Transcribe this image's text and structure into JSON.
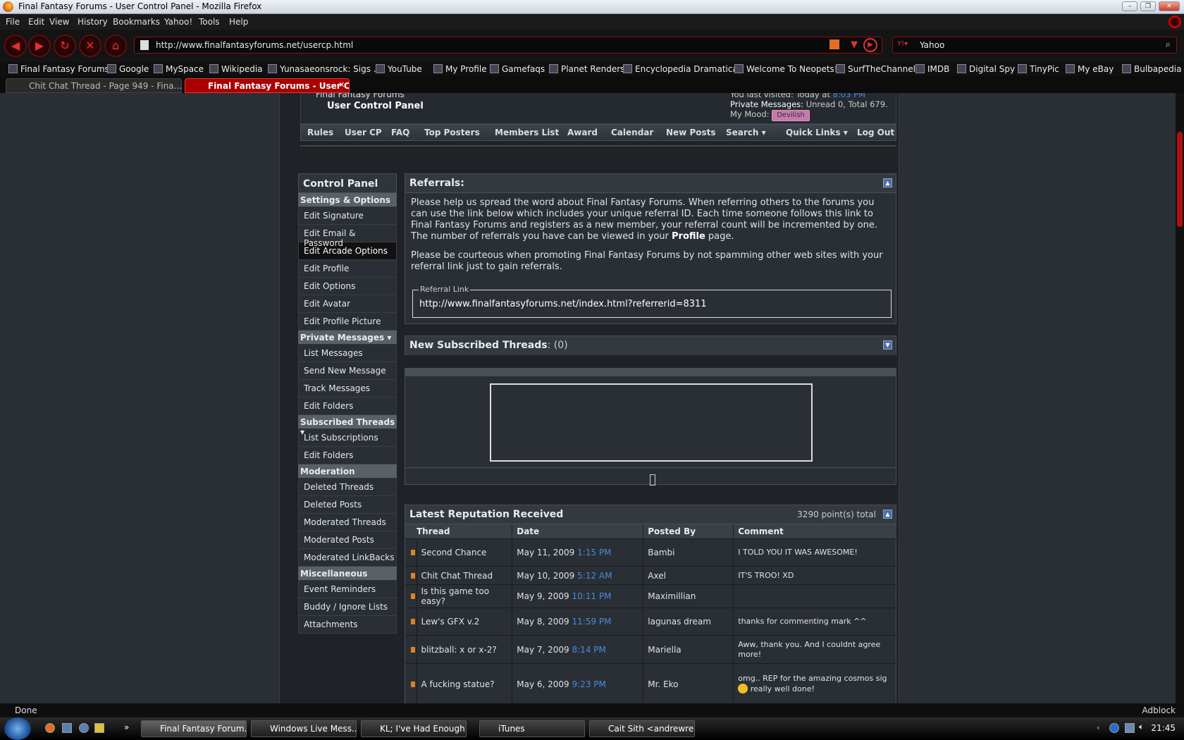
{
  "window": {
    "title": "Final Fantasy Forums - User Control Panel - Mozilla Firefox"
  },
  "menu": [
    "File",
    "Edit",
    "View",
    "History",
    "Bookmarks",
    "Yahoo!",
    "Tools",
    "Help"
  ],
  "nav": {
    "url": "http://www.finalfantasyforums.net/usercp.html",
    "search_value": "Yahoo"
  },
  "bookmarks": [
    "Final Fantasy Forums",
    "Google",
    "MySpace",
    "Wikipedia",
    "Yunasaeonsrock: Sigs ...",
    "YouTube",
    "My Profile",
    "Gamefaqs",
    "Planet Renders",
    "Encyclopedia Dramatica",
    "Welcome To Neopets!",
    "SurfTheChannel",
    "IMDB",
    "Digital Spy",
    "TinyPic",
    "My eBay",
    "Bulbapedia"
  ],
  "tabs": [
    "Chit Chat Thread - Page 949 - Fina...",
    "Final Fantasy Forums - User Cont..."
  ],
  "header": {
    "breadcrumb_root": "Final Fantasy Forums",
    "breadcrumb_current": "User Control Panel",
    "last_visited_label": "You last visited: Today at ",
    "last_visited_time": "8:03 PM",
    "pm_label": "Private Messages:",
    "pm_value": "Unread 0, Total 679.",
    "mood_label": "My Mood:",
    "mood_value": "Devilish"
  },
  "forum_nav": [
    "Rules",
    "User CP",
    "FAQ",
    "Top Posters",
    "Members List",
    "Award",
    "Calendar",
    "New Posts",
    "Search",
    "Quick Links",
    "Log Out"
  ],
  "sidebar": {
    "title": "Control Panel",
    "sections": [
      {
        "name": "Settings & Options",
        "items": [
          "Edit Signature",
          "Edit Email & Password",
          "Edit Arcade Options",
          "Edit Profile",
          "Edit Options",
          "Edit Avatar",
          "Edit Profile Picture"
        ]
      },
      {
        "name": "Private Messages",
        "items": [
          "List Messages",
          "Send New Message",
          "Track Messages",
          "Edit Folders"
        ]
      },
      {
        "name": "Subscribed Threads",
        "items": [
          "List Subscriptions",
          "Edit Folders"
        ]
      },
      {
        "name": "Moderation",
        "items": [
          "Deleted Threads",
          "Deleted Posts",
          "Moderated Threads",
          "Moderated Posts",
          "Moderated LinkBacks"
        ]
      },
      {
        "name": "Miscellaneous",
        "items": [
          "Event Reminders",
          "Buddy / Ignore Lists",
          "Attachments"
        ]
      }
    ]
  },
  "referrals": {
    "title": "Referrals:",
    "para1_a": "Please help us spread the word about Final Fantasy Forums. When referring others to the forums you can use the link below which includes your unique referral ID. Each time someone follows this link to Final Fantasy Forums and registers as a new member, your referral count will be incremented by one. The number of referrals you have can be viewed in your ",
    "para1_bold": "Profile",
    "para1_b": " page.",
    "para2": "Please be courteous when promoting Final Fantasy Forums by not spamming other web sites with your referral link just to gain referrals.",
    "link_legend": "Referral Link",
    "link_value": "http://www.finalfantasyforums.net/index.html?referrerid=8311"
  },
  "subscribed": {
    "title": "New Subscribed Threads",
    "count": ": (0)"
  },
  "reputation": {
    "title": "Latest Reputation Received",
    "total": "3290 point(s) total",
    "columns": [
      "Thread",
      "Date",
      "Posted By",
      "Comment"
    ],
    "rows": [
      {
        "thread": "Second Chance",
        "date": "May 11, 2009",
        "time": "1:15 PM",
        "by": "Bambi",
        "comment": "I TOLD YOU IT WAS AWESOME!"
      },
      {
        "thread": "Chit Chat Thread",
        "date": "May 10, 2009",
        "time": "5:12 AM",
        "by": "Axel",
        "comment": "IT'S TROO! XD"
      },
      {
        "thread": "Is this game too easy?",
        "date": "May 9, 2009",
        "time": "10:11 PM",
        "by": "Maximillian",
        "comment": ""
      },
      {
        "thread": "Lew's GFX v.2",
        "date": "May 8, 2009",
        "time": "11:59 PM",
        "by": "lagunas dream",
        "comment": "thanks for commenting mark ^^"
      },
      {
        "thread": "blitzball: x or x-2?",
        "date": "May 7, 2009",
        "time": "8:14 PM",
        "by": "Mariella",
        "comment": "Aww, thank you. And I couldnt agree more!"
      },
      {
        "thread": "A fucking statue?",
        "date": "May 6, 2009",
        "time": "9:23 PM",
        "by": "Mr. Eko",
        "comment_a": "omg.. REP for the amazing cosmos sig ",
        "comment_b": " really well done!"
      }
    ]
  },
  "status": {
    "left": "Done",
    "right": "Adblock"
  },
  "taskbar": {
    "items": [
      "Final Fantasy Forum...",
      "Windows Live Mess...",
      "KL; I've Had Enough...",
      "iTunes",
      "Cait Sith <andrewre..."
    ],
    "clock": "21:45"
  }
}
